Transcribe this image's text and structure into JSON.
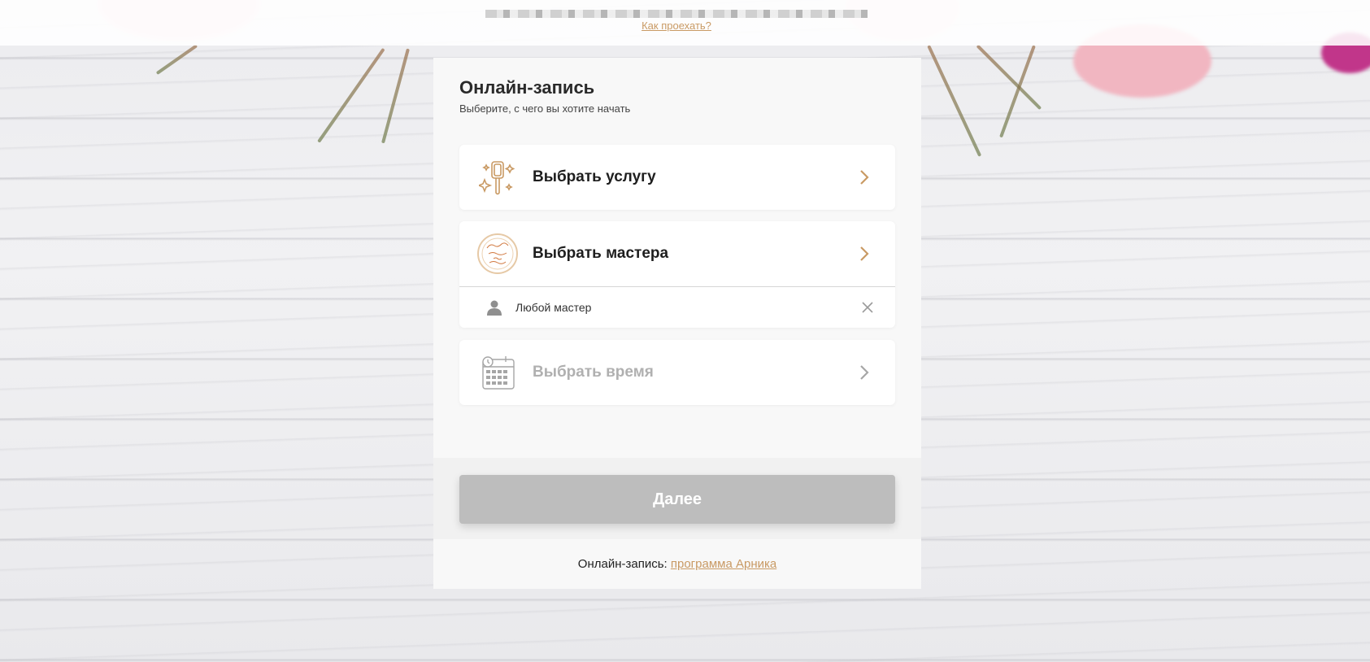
{
  "header": {
    "directions_link": "Как проехать?"
  },
  "panel": {
    "title": "Онлайн-запись",
    "subtitle": "Выберите, с чего вы хотите начать",
    "options": [
      {
        "label": "Выбрать услугу",
        "icon": "hand-mirror-icon",
        "disabled": false
      },
      {
        "label": "Выбрать мастера",
        "icon": "salon-logo-avatar",
        "disabled": false
      },
      {
        "label": "Выбрать время",
        "icon": "calendar-clock-icon",
        "disabled": true
      }
    ],
    "selected_master": {
      "label": "Любой мастер",
      "icon": "person-icon"
    },
    "next_button": "Далее",
    "powered_prefix": "Онлайн-запись:",
    "powered_link": "программа Арника"
  },
  "colors": {
    "accent": "#c99a64",
    "icon_orange": "#d0763c",
    "button_disabled": "#bdbdbd"
  }
}
